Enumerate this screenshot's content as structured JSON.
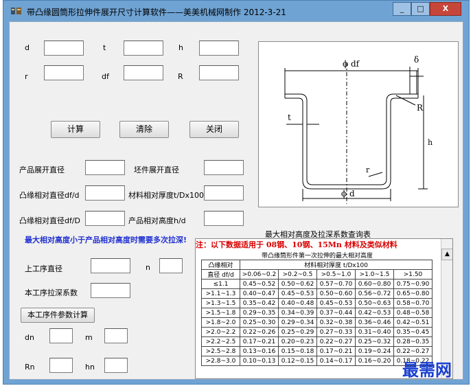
{
  "window": {
    "title": "带凸缘圆筒形拉伸件展开尺寸计算软件——美美机械网制作  2012-3-21",
    "icon_name": "app-logo-icon",
    "min_label": "_",
    "max_label": "□",
    "close_label": "X"
  },
  "inputs": {
    "d_label": "d",
    "t_label": "t",
    "h_label": "h",
    "r_label": "r",
    "df_label": "df",
    "R_label": "R"
  },
  "buttons": {
    "calc": "计算",
    "clear": "清除",
    "close": "关闭",
    "step_calc": "本工序件参数计算"
  },
  "results": {
    "product_dia": "产品展开直径",
    "blank_dia": "坯件展开直径",
    "flange_rel_d": "凸缘相对直径df/d",
    "mat_rel_thk": "材料相对厚度t/Dx100",
    "flange_rel_D": "凸缘相对直径df/D",
    "prod_rel_h": "产品相对高度h/d"
  },
  "note": "最大相对高度小于产品相对高度时需要多次拉深!",
  "process": {
    "prev_dia": "上工序直径",
    "n_label": "n",
    "coef": "本工序拉深系数",
    "dn": "dn",
    "m": "m",
    "Rn": "Rn",
    "hn": "hn"
  },
  "diagram": {
    "phi_df": "ϕ df",
    "delta": "δ",
    "R": "R",
    "t": "t",
    "r": "r",
    "h": "h",
    "phi_d": "ϕ d"
  },
  "table": {
    "title": "最大相对高度及拉深系数查询表",
    "note": "注：以下数据适用于 08钢、10钢、15Mn 材料及类似材料",
    "subtitle": "带凸缘筒形件第一次拉伸的最大相对高度",
    "h1": "凸缘相对",
    "h2": "直径 df/d",
    "thk_header": "材料相对厚度 t/Dx100",
    "cols": [
      ">0.06~0.2",
      ">0.2~0.5",
      ">0.5~1.0",
      ">1.0~1.5",
      ">1.50"
    ],
    "rows": [
      [
        "≤1.1",
        "0.45~0.52",
        "0.50~0.62",
        "0.57~0.70",
        "0.60~0.80",
        "0.75~0.90"
      ],
      [
        ">1.1~1.3",
        "0.40~0.47",
        "0.45~0.53",
        "0.50~0.60",
        "0.56~0.72",
        "0.65~0.80"
      ],
      [
        ">1.3~1.5",
        "0.35~0.42",
        "0.40~0.48",
        "0.45~0.53",
        "0.50~0.63",
        "0.58~0.70"
      ],
      [
        ">1.5~1.8",
        "0.29~0.35",
        "0.34~0.39",
        "0.37~0.44",
        "0.42~0.53",
        "0.48~0.58"
      ],
      [
        ">1.8~2.0",
        "0.25~0.30",
        "0.29~0.34",
        "0.32~0.38",
        "0.36~0.46",
        "0.42~0.51"
      ],
      [
        ">2.0~2.2",
        "0.22~0.26",
        "0.25~0.29",
        "0.27~0.33",
        "0.31~0.40",
        "0.35~0.45"
      ],
      [
        ">2.2~2.5",
        "0.17~0.21",
        "0.20~0.23",
        "0.22~0.27",
        "0.25~0.32",
        "0.28~0.35"
      ],
      [
        ">2.5~2.8",
        "0.13~0.16",
        "0.15~0.18",
        "0.17~0.21",
        "0.19~0.24",
        "0.22~0.27"
      ],
      [
        ">2.8~3.0",
        "0.10~0.13",
        "0.12~0.15",
        "0.14~0.17",
        "0.16~0.20",
        "0.18~0.22"
      ]
    ]
  },
  "watermark": "最需网"
}
